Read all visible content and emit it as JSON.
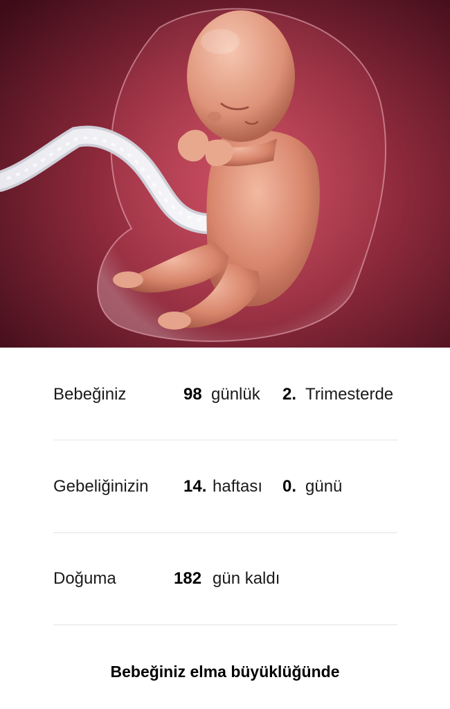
{
  "illustration": {
    "subject": "fetus-illustration"
  },
  "stats": {
    "age": {
      "label": "Bebeğiniz",
      "days_value": "98",
      "days_unit": "günlük",
      "trimester_value": "2.",
      "trimester_unit": "Trimesterde"
    },
    "pregnancy": {
      "label": "Gebeliğinizin",
      "week_value": "14.",
      "week_unit": "haftası",
      "day_value": "0.",
      "day_unit": "günü"
    },
    "due": {
      "label": "Doğuma",
      "days_value": "182",
      "days_unit": "gün kaldı"
    }
  },
  "size_comparison": "Bebeğiniz elma büyüklüğünde",
  "colors": {
    "background_dark": "#4a0f1c",
    "background_mid": "#a8374a",
    "skin": "#d98c74",
    "divider": "#e3e3e3"
  }
}
